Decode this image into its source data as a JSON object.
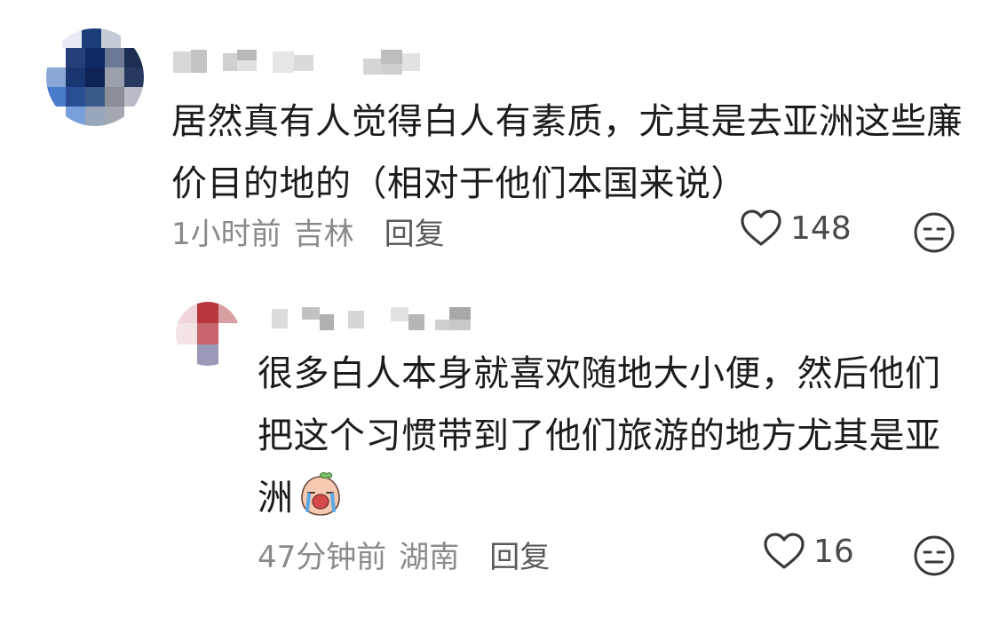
{
  "comments": [
    {
      "author_hidden": true,
      "text": "居然真有人觉得白人有素质，尤其是去亚洲这些廉价目的地的（相对于他们本国来说）",
      "time": "1小时前",
      "location": "吉林",
      "reply_label": "回复",
      "likes": "148"
    },
    {
      "author_hidden": true,
      "text": "很多白人本身就喜欢随地大小便，然后他们把这个习惯带到了他们旅游的地方尤其是亚洲",
      "time": "47分钟前",
      "location": "湖南",
      "reply_label": "回复",
      "likes": "16",
      "sticker_icon": "crying-face-sticker"
    }
  ],
  "colors": {
    "text": "#1c1c1c",
    "meta": "#8a8a8a",
    "reply": "#5a5a5a",
    "icon": "#3a3a3a"
  }
}
